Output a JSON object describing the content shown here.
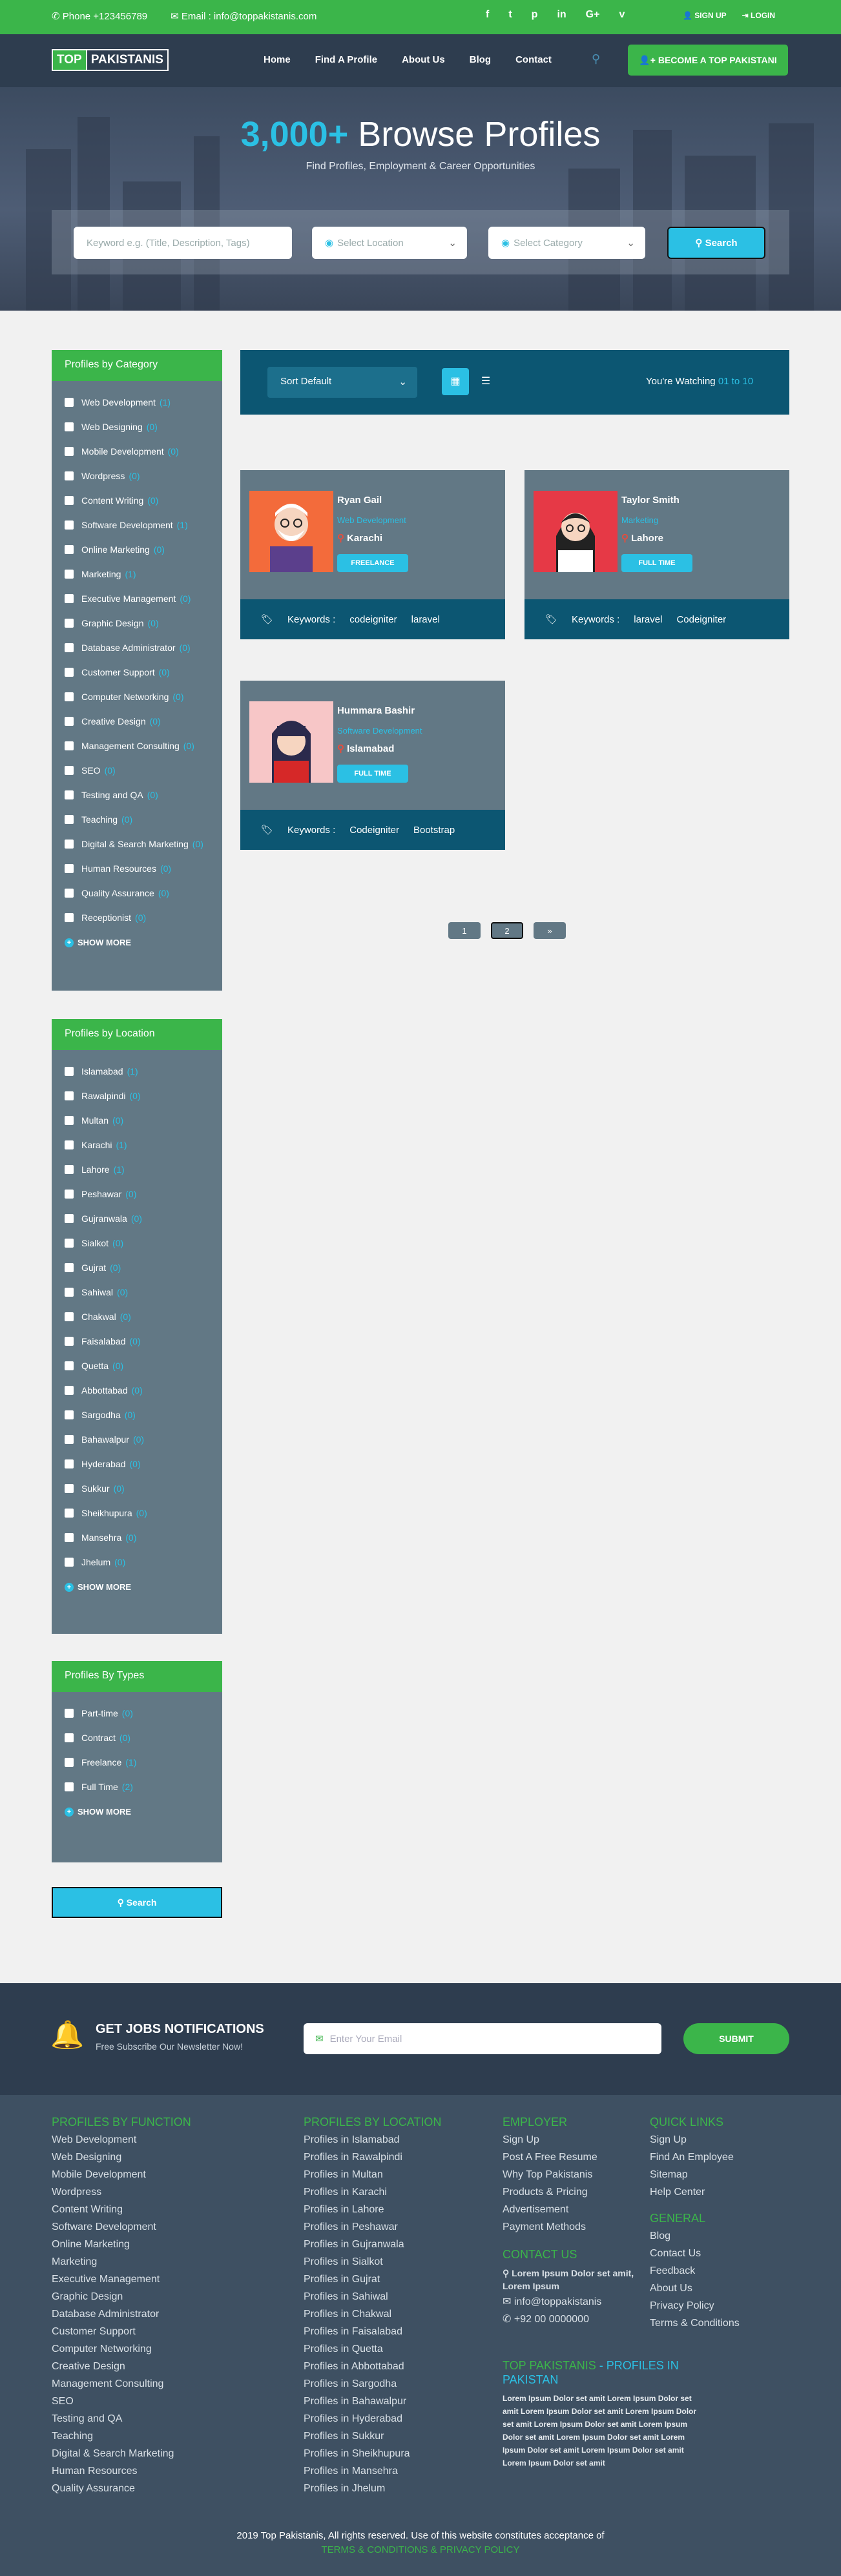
{
  "topbar": {
    "phone": "Phone +123456789",
    "email": "Email : info@toppakistanis.com",
    "social": [
      "f",
      "t",
      "p",
      "in",
      "G+",
      "v"
    ],
    "signup": "SIGN UP",
    "login": "LOGIN"
  },
  "logo": {
    "part1": "TOP",
    "part2": "PAKISTANIS"
  },
  "nav": {
    "items": [
      "Home",
      "Find A Profile",
      "About Us",
      "Blog",
      "Contact"
    ],
    "become": "BECOME A TOP PAKISTANI"
  },
  "hero": {
    "count": "3,000+",
    "title": "Browse Profiles",
    "subtitle": "Find Profiles, Employment & Career Opportunities"
  },
  "search": {
    "keyword_placeholder": "Keyword e.g. (Title, Description, Tags)",
    "location": "Select Location",
    "category": "Select Category",
    "button": "Search"
  },
  "category": {
    "title": "Profiles by Category",
    "items": [
      {
        "label": "Web Development",
        "count": "(1)"
      },
      {
        "label": "Web Designing",
        "count": "(0)"
      },
      {
        "label": "Mobile Development",
        "count": "(0)"
      },
      {
        "label": "Wordpress",
        "count": "(0)"
      },
      {
        "label": "Content Writing",
        "count": "(0)"
      },
      {
        "label": "Software Development",
        "count": "(1)"
      },
      {
        "label": "Online Marketing",
        "count": "(0)"
      },
      {
        "label": "Marketing",
        "count": "(1)"
      },
      {
        "label": "Executive Management",
        "count": "(0)"
      },
      {
        "label": "Graphic Design",
        "count": "(0)"
      },
      {
        "label": "Database Administrator",
        "count": "(0)"
      },
      {
        "label": "Customer Support",
        "count": "(0)"
      },
      {
        "label": "Computer Networking",
        "count": "(0)"
      },
      {
        "label": "Creative Design",
        "count": "(0)"
      },
      {
        "label": "Management Consulting",
        "count": "(0)"
      },
      {
        "label": "SEO",
        "count": "(0)"
      },
      {
        "label": "Testing and QA",
        "count": "(0)"
      },
      {
        "label": "Teaching",
        "count": "(0)"
      },
      {
        "label": "Digital & Search Marketing",
        "count": "(0)"
      },
      {
        "label": "Human Resources",
        "count": "(0)"
      },
      {
        "label": "Quality Assurance",
        "count": "(0)"
      },
      {
        "label": "Receptionist",
        "count": "(0)"
      }
    ],
    "more": "SHOW MORE"
  },
  "location": {
    "title": "Profiles by Location",
    "items": [
      {
        "label": "Islamabad",
        "count": "(1)"
      },
      {
        "label": "Rawalpindi",
        "count": "(0)"
      },
      {
        "label": "Multan",
        "count": "(0)"
      },
      {
        "label": "Karachi",
        "count": "(1)"
      },
      {
        "label": "Lahore",
        "count": "(1)"
      },
      {
        "label": "Peshawar",
        "count": "(0)"
      },
      {
        "label": "Gujranwala",
        "count": "(0)"
      },
      {
        "label": "Sialkot",
        "count": "(0)"
      },
      {
        "label": "Gujrat",
        "count": "(0)"
      },
      {
        "label": "Sahiwal",
        "count": "(0)"
      },
      {
        "label": "Chakwal",
        "count": "(0)"
      },
      {
        "label": "Faisalabad",
        "count": "(0)"
      },
      {
        "label": "Quetta",
        "count": "(0)"
      },
      {
        "label": "Abbottabad",
        "count": "(0)"
      },
      {
        "label": "Sargodha",
        "count": "(0)"
      },
      {
        "label": "Bahawalpur",
        "count": "(0)"
      },
      {
        "label": "Hyderabad",
        "count": "(0)"
      },
      {
        "label": "Sukkur",
        "count": "(0)"
      },
      {
        "label": "Sheikhupura",
        "count": "(0)"
      },
      {
        "label": "Mansehra",
        "count": "(0)"
      },
      {
        "label": "Jhelum",
        "count": "(0)"
      }
    ],
    "more": "SHOW MORE"
  },
  "types": {
    "title": "Profiles By Types",
    "items": [
      {
        "label": "Part-time",
        "count": "(0)"
      },
      {
        "label": "Contract",
        "count": "(0)"
      },
      {
        "label": "Freelance",
        "count": "(1)"
      },
      {
        "label": "Full Time",
        "count": "(2)"
      }
    ],
    "more": "SHOW MORE"
  },
  "side_search": "Search",
  "sort": {
    "label": "Sort Default",
    "watching": "You're Watching",
    "range": "01 to 10"
  },
  "profiles": [
    {
      "name": "Ryan Gail",
      "title": "Web Development",
      "location": "Karachi",
      "type": "FREELANCE",
      "keywords_label": "Keywords :",
      "keywords": [
        "codeigniter",
        "laravel"
      ],
      "bg": "#f36b3b"
    },
    {
      "name": "Taylor Smith",
      "title": "Marketing",
      "location": "Lahore",
      "type": "FULL TIME",
      "keywords_label": "Keywords :",
      "keywords": [
        "laravel",
        "Codeigniter"
      ],
      "bg": "#e63946"
    },
    {
      "name": "Hummara Bashir",
      "title": "Software Development",
      "location": "Islamabad",
      "type": "FULL TIME",
      "keywords_label": "Keywords :",
      "keywords": [
        "Codeigniter",
        "Bootstrap"
      ],
      "bg": "#f7c6c7"
    }
  ],
  "pagination": [
    "1",
    "2",
    "»"
  ],
  "newsletter": {
    "title": "GET JOBS NOTIFICATIONS",
    "subtitle": "Free Subscribe Our Newsletter Now!",
    "placeholder": "Enter Your Email",
    "button": "SUBMIT"
  },
  "footer": {
    "function": {
      "title": "PROFILES BY FUNCTION",
      "items": [
        "Web Development",
        "Web Designing",
        "Mobile Development",
        "Wordpress",
        "Content Writing",
        "Software Development",
        "Online Marketing",
        "Marketing",
        "Executive Management",
        "Graphic Design",
        "Database Administrator",
        "Customer Support",
        "Computer Networking",
        "Creative Design",
        "Management Consulting",
        "SEO",
        "Testing and QA",
        "Teaching",
        "Digital & Search Marketing",
        "Human Resources",
        "Quality Assurance"
      ]
    },
    "location": {
      "title": "PROFILES BY LOCATION",
      "items": [
        "Profiles in Islamabad",
        "Profiles in Rawalpindi",
        "Profiles in Multan",
        "Profiles in Karachi",
        "Profiles in Lahore",
        "Profiles in Peshawar",
        "Profiles in Gujranwala",
        "Profiles in Sialkot",
        "Profiles in Gujrat",
        "Profiles in Sahiwal",
        "Profiles in Chakwal",
        "Profiles in Faisalabad",
        "Profiles in Quetta",
        "Profiles in Abbottabad",
        "Profiles in Sargodha",
        "Profiles in Bahawalpur",
        "Profiles in Hyderabad",
        "Profiles in Sukkur",
        "Profiles in Sheikhupura",
        "Profiles in Mansehra",
        "Profiles in Jhelum"
      ]
    },
    "employer": {
      "title": "EMPLOYER",
      "items": [
        "Sign Up",
        "Post A Free Resume",
        "Why Top Pakistanis",
        "Products & Pricing",
        "Advertisement",
        "Payment Methods"
      ]
    },
    "contact": {
      "title": "CONTACT US",
      "address": "Lorem Ipsum Dolor set amit, Lorem Ipsum",
      "email": "info@toppakistanis",
      "phone": "+92 00 0000000"
    },
    "quick": {
      "title": "QUICK LINKS",
      "items": [
        "Sign Up",
        "Find An Employee",
        "Sitemap",
        "Help Center"
      ]
    },
    "general": {
      "title": "GENERAL",
      "items": [
        "Blog",
        "Contact Us",
        "Feedback",
        "About Us",
        "Privacy Policy",
        "Terms & Conditions"
      ]
    },
    "about": {
      "title1": "TOP PAKISTANIS",
      "title2": "- PROFILES IN PAKISTAN",
      "text": "Lorem Ipsum Dolor set amit Lorem Ipsum Dolor set amit Lorem Ipsum Dolor set amit Lorem Ipsum Dolor set amit Lorem Ipsum Dolor set amit Lorem Ipsum Dolor set amit Lorem Ipsum Dolor set amit Lorem Ipsum Dolor set amit Lorem Ipsum Dolor set amit Lorem Ipsum Dolor set amit"
    },
    "copyright": "2019 Top Pakistanis, All rights reserved. Use of this website constitutes acceptance of",
    "terms": "TERMS & CONDITIONS",
    "amp": "&",
    "privacy": "PRIVACY POLICY"
  }
}
